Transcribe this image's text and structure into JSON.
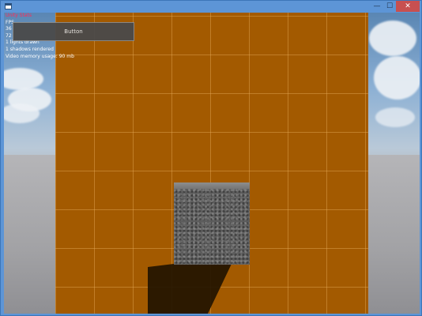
{
  "window": {
    "icon": "app-window-icon",
    "controls": {
      "minimize_glyph": "—",
      "maximize_glyph": "☐",
      "close_glyph": "✕"
    }
  },
  "hud": {
    "lines": [
      "Unity Stats",
      "FPS",
      "36",
      "72",
      "1 lights drawn",
      "1 shadows rendered",
      "Video memory usage: 90 mb"
    ]
  },
  "gui_button": {
    "label": "Button"
  },
  "colors": {
    "ground": "#a35a00",
    "grid_lines": "#e6aa5a",
    "cube": "#5c5c5c",
    "hud_title": "#ff2a5a",
    "titlebar": "#5d95d6",
    "close_button": "#c75050"
  }
}
